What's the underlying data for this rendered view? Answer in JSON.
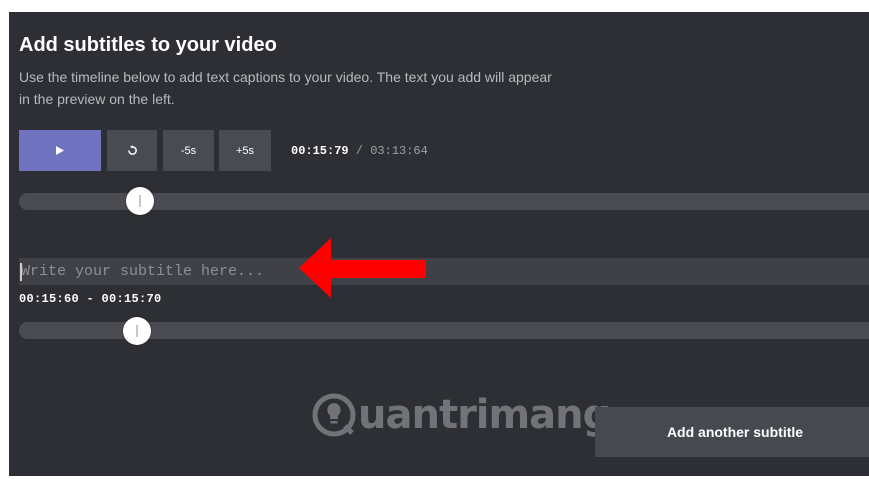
{
  "header": {
    "title": "Add subtitles to your video",
    "description": "Use the timeline below to add text captions to your video. The text you add will appear in the preview on the left."
  },
  "controls": {
    "play_icon": "play-icon",
    "replay_icon": "replay-icon",
    "back_label": "-5s",
    "forward_label": "+5s",
    "current_time": "00:15:79",
    "separator": " / ",
    "total_time": "03:13:64",
    "accent_color": "#6f73bf"
  },
  "subtitle": {
    "placeholder": "Write your subtitle here...",
    "value": "",
    "range": "00:15:60 - 00:15:70"
  },
  "actions": {
    "add_another_label": "Add another subtitle"
  },
  "annotation": {
    "arrow_color": "#ff0000"
  },
  "watermark": {
    "text": "uantrimang"
  }
}
